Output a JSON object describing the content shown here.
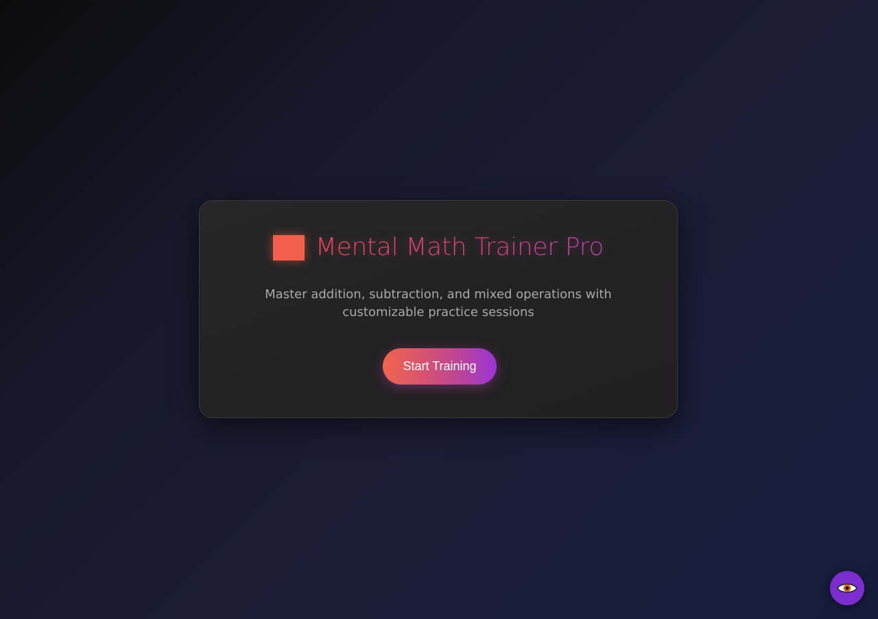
{
  "card": {
    "title": "Mental Math Trainer Pro",
    "subtitle": "Master addition, subtraction, and mixed operations with customizable practice sessions",
    "start_button_label": "Start Training",
    "logo_icon": "orange-square-icon"
  },
  "floating_button": {
    "icon": "eye-icon",
    "color": "#7b2dd0"
  },
  "colors": {
    "accent_orange": "#f0604d",
    "accent_pink": "#d4417e",
    "accent_purple": "#9b34d6"
  }
}
